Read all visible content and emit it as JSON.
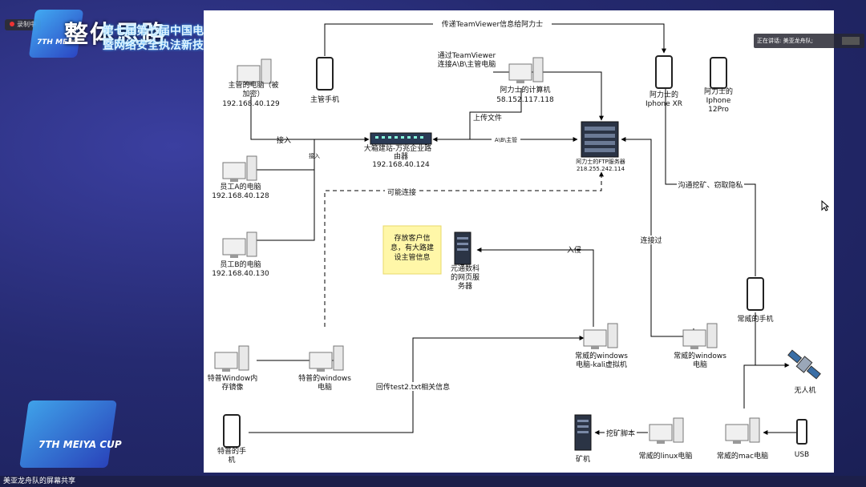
{
  "recording": {
    "label": "录制中"
  },
  "slide": {
    "title": "整体思路",
    "subtitle_line1": "第七届第七届中国电子数据取证大赛",
    "subtitle_line2": "暨网络安全执法新技术研讨会",
    "logo_top_text": "7TH MEIYA",
    "logo_bottom_text": "7TH MEIYA CUP"
  },
  "speaker": {
    "label": "正在讲话: 美亚龙舟队;"
  },
  "share_bar": {
    "label": "美亚龙舟队的屏幕共享"
  },
  "diagram": {
    "router": {
      "line1": "大箱建站-万兆企业路",
      "line2": "由器",
      "ip": "192.168.40.124"
    },
    "server": {
      "line1": "阿力士的FTP服务器",
      "ip": "218.255.242.114"
    },
    "boss_pc": {
      "line1": "主管的电脑（被",
      "line2": "加密）",
      "ip": "192.168.40.129"
    },
    "boss_phone": {
      "label": "主管手机"
    },
    "ali_pc": {
      "line1": "阿力士的计算机",
      "ip": "58.152.117.118"
    },
    "ali_phone": {
      "line1": "阿力士的",
      "line2": "Iphone XR"
    },
    "ali_wife_phone": {
      "line1": "阿力士的",
      "line2": "Iphone",
      "line3": "12Pro"
    },
    "employee_a": {
      "line1": "员工A的电脑",
      "ip": "192.168.40.128"
    },
    "employee_b": {
      "line1": "员工B的电脑",
      "ip": "192.168.40.130"
    },
    "cloud_server": {
      "line1": "元通数科",
      "line2": "的网页服",
      "line3": "务器"
    },
    "note": {
      "line1": "存放客户信",
      "line2": "息，有大路建",
      "line3": "设主管信息"
    },
    "tepu_win_mem": {
      "line1": "特普Window内",
      "line2": "存镜像"
    },
    "tepu_win_pc": {
      "line1": "特普的windows",
      "line2": "电脑"
    },
    "tepu_phone": {
      "line1": "特普的手",
      "line2": "机"
    },
    "cw_kali": {
      "line1": "常威的windows",
      "line2": "电脑-kali虚拟机"
    },
    "cw_win": {
      "line1": "常威的windows",
      "line2": "电脑"
    },
    "cw_phone": {
      "line1": "常威的手机"
    },
    "drone": {
      "label": "无人机"
    },
    "miner": {
      "label": "矿机"
    },
    "cw_linux": {
      "label": "常威的linux电脑"
    },
    "cw_mac": {
      "label": "常威的mac电脑"
    },
    "usb": {
      "label": "USB"
    },
    "edges": {
      "teamviewer_info": "传递TeamViewer信息给阿力士",
      "teamviewer_connect_1": "通过TeamViewer",
      "teamviewer_connect_2": "连接A\\B\\主管电脑",
      "upload": "上传文件",
      "access1": "接入",
      "access2": "接入",
      "ab_boss": "A\\B\\主管",
      "possible": "可能连接",
      "invade": "入侵",
      "connected": "连接过",
      "mining_privacy": "沟通挖矿、窃取隐私",
      "return_test2": "回传test2.txt相关信息",
      "mining_script": "挖矿脚本"
    }
  }
}
